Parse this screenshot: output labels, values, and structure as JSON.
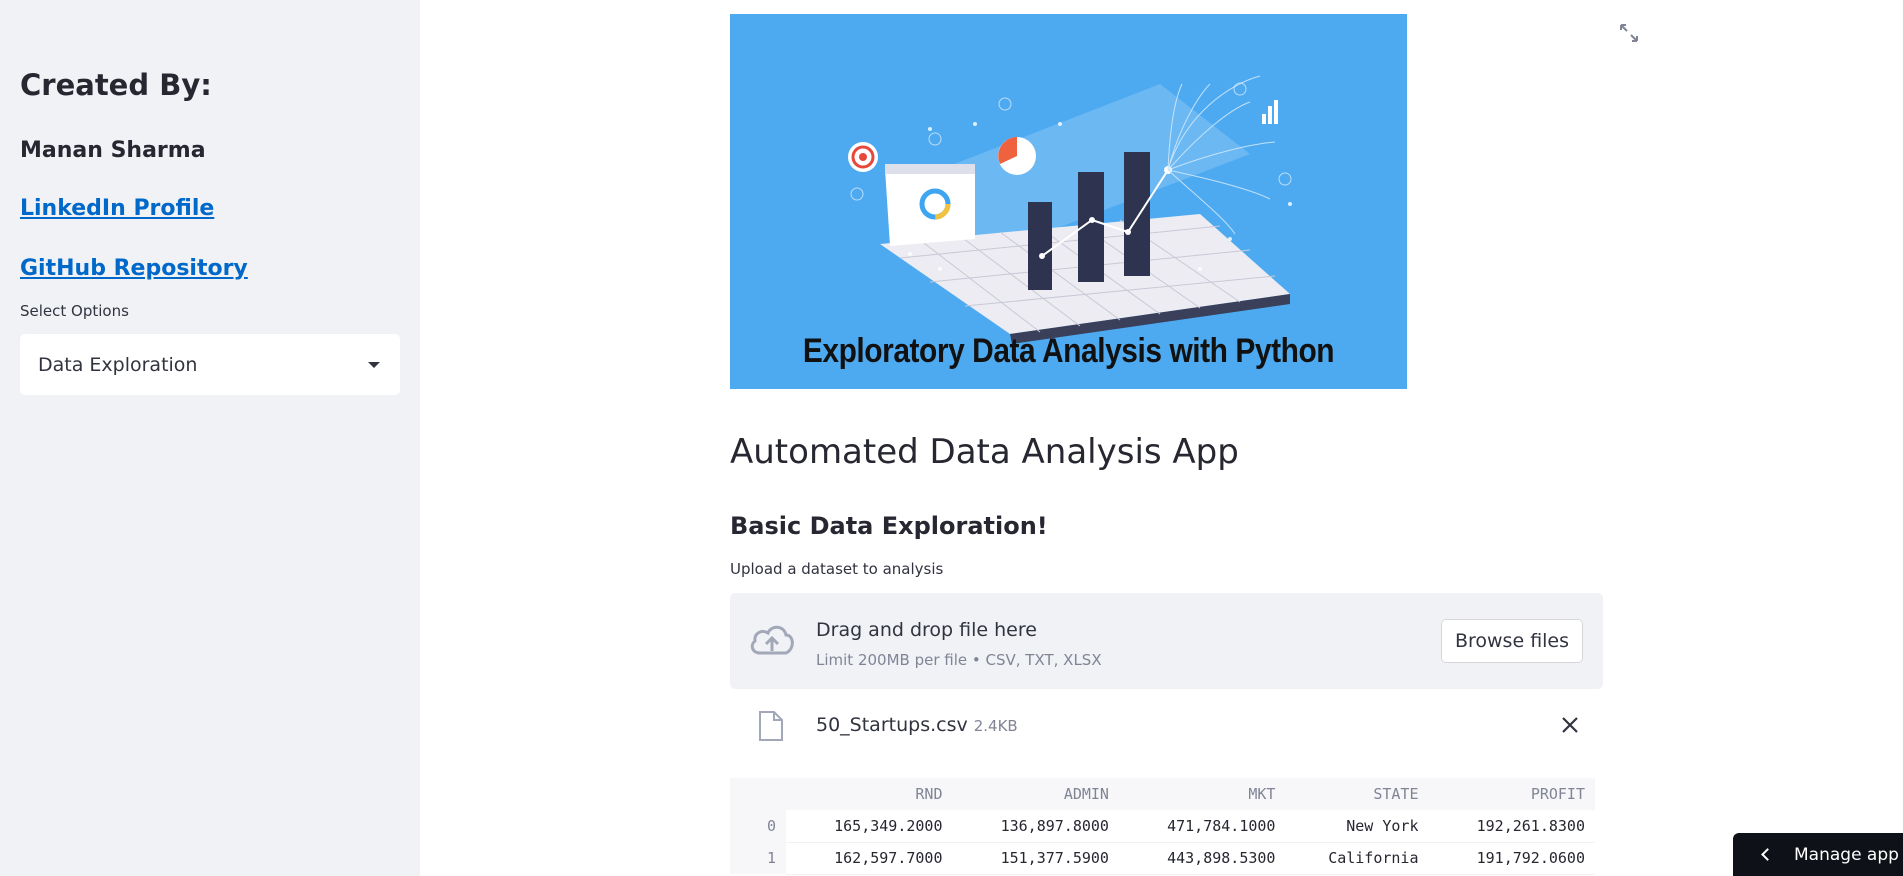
{
  "sidebar": {
    "heading": "Created By:",
    "author": "Manan Sharma",
    "linkedin_label": "LinkedIn Profile",
    "github_label": "GitHub Repository",
    "select_label": "Select Options",
    "select_value": "Data Exploration"
  },
  "hero": {
    "caption": "Exploratory Data Analysis with Python"
  },
  "main": {
    "title": "Automated Data Analysis App",
    "section_title": "Basic Data Exploration!",
    "upload_label": "Upload a dataset to analysis",
    "dropzone_text": "Drag and drop file here",
    "dropzone_limit": "Limit 200MB per file • CSV, TXT, XLSX",
    "browse_label": "Browse files",
    "file_name": "50_Startups.csv",
    "file_size": "2.4KB"
  },
  "table": {
    "columns": [
      "RND",
      "ADMIN",
      "MKT",
      "STATE",
      "PROFIT"
    ],
    "rows": [
      {
        "index": "0",
        "cells": [
          "165,349.2000",
          "136,897.8000",
          "471,784.1000",
          "New York",
          "192,261.8300"
        ]
      },
      {
        "index": "1",
        "cells": [
          "162,597.7000",
          "151,377.5900",
          "443,898.5300",
          "California",
          "191,792.0600"
        ]
      }
    ]
  },
  "manage_app_label": "Manage app",
  "colors": {
    "sidebar_bg": "#f0f2f6",
    "link": "#0068c9",
    "hero_bg": "#4eaaf0",
    "manage_bg": "#0e1117"
  },
  "icons": [
    "expand-icon",
    "caret-down-icon",
    "cloud-upload-icon",
    "file-icon",
    "close-icon",
    "chevron-left-icon"
  ]
}
